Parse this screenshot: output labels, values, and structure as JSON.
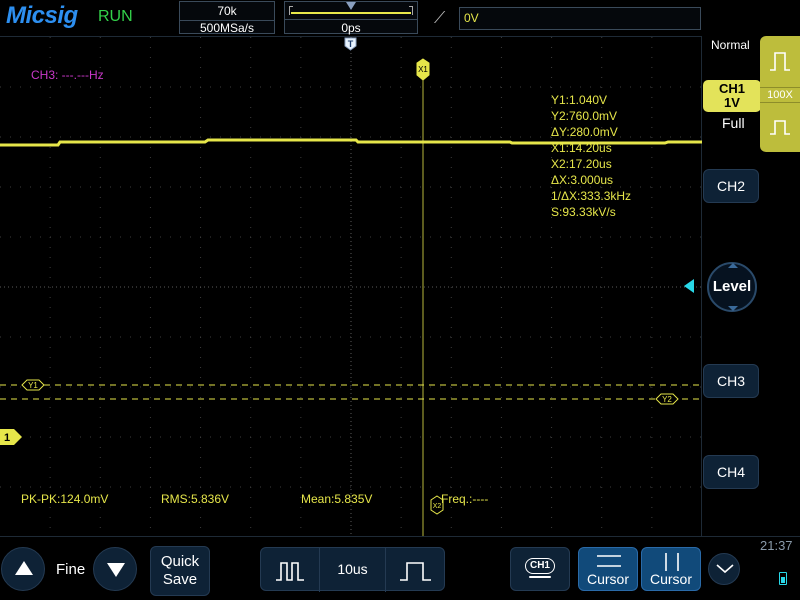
{
  "header": {
    "logo": "Micsig",
    "run_state": "RUN",
    "sample_depth": "70k",
    "sample_rate": "500MSa/s",
    "horizontal_position": "0ps",
    "trigger_edge_icon": "rising-edge-icon",
    "trigger_level": "␸0V"
  },
  "screen": {
    "ch3_frequency": "CH3: ---.---Hz",
    "cursor_x1_label": "X1",
    "cursor_x2_label": "X2",
    "cursor_y1_label": "Y1",
    "cursor_y2_label": "Y2",
    "trigger_pos_label": "T",
    "channel_marker": "1",
    "cursor_readouts": [
      "Y1:1.040V",
      "Y2:760.0mV",
      "ΔY:280.0mV",
      "X1:14.20us",
      "X2:17.20us",
      "ΔX:3.000us",
      "1/ΔX:333.3kHz",
      "S:93.33kV/s"
    ],
    "measurements": {
      "pkpk": "PK-PK:124.0mV",
      "rms": "RMS:5.836V",
      "mean": "Mean:5.835V",
      "freq": "Freq.:----"
    }
  },
  "right_panel": {
    "trigger_mode": "Normal",
    "ch1_name": "CH1",
    "ch1_scale": "1V",
    "bandwidth": "Full",
    "probe_ratio": "100X",
    "ch2": "CH2",
    "level": "Level",
    "ch3": "CH3",
    "ch4": "CH4"
  },
  "bottom": {
    "fine_label": "Fine",
    "quick_save_line1": "Quick",
    "quick_save_line2": "Save",
    "timebase": "10us",
    "channel_select": "CH1",
    "cursor_h_label": "Cursor",
    "cursor_v_label": "Cursor",
    "clock": "21:37"
  },
  "colors": {
    "ch1": "#e6e64a",
    "ch3": "#c838c8",
    "accent": "#2d8ff0",
    "run": "#33d14a",
    "trigger_level": "#28d8e8"
  }
}
